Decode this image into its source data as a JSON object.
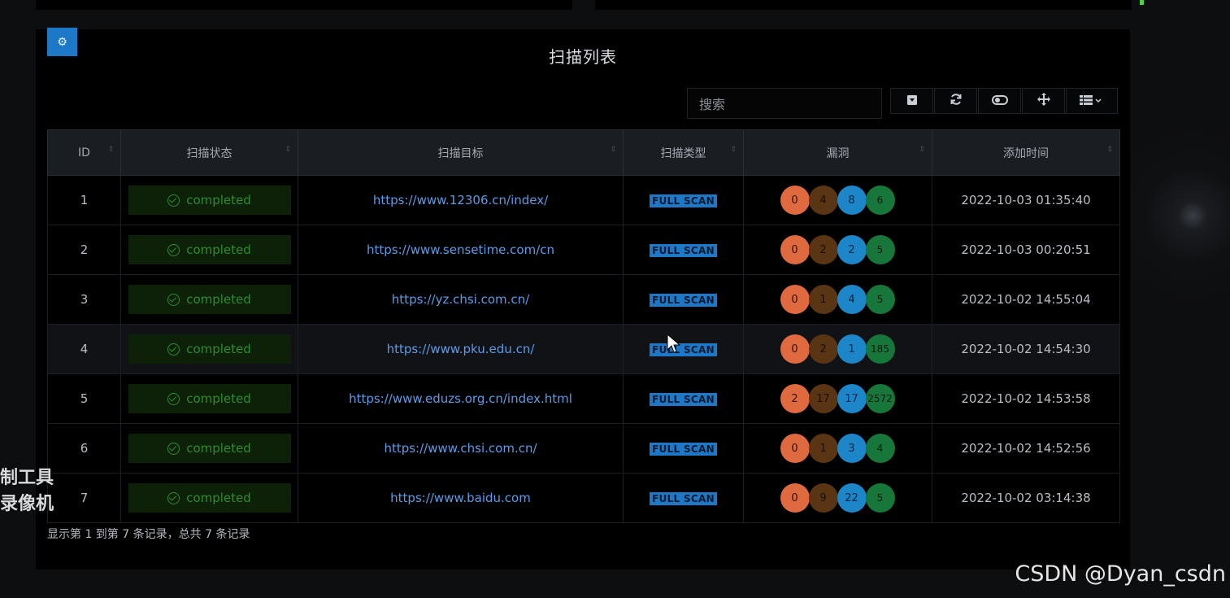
{
  "page": {
    "title": "扫描列表",
    "search_placeholder": "搜索"
  },
  "toolbar": {
    "buttons": [
      {
        "icon": "collapse-icon",
        "glyph": "▾"
      },
      {
        "icon": "refresh-icon",
        "glyph": "⟳"
      },
      {
        "icon": "toggle-icon",
        "glyph": "⊂⊃"
      },
      {
        "icon": "move-icon",
        "glyph": "✥"
      },
      {
        "icon": "columns-icon",
        "glyph": "☰ ⌄"
      }
    ]
  },
  "table": {
    "headers": [
      "ID",
      "扫描状态",
      "扫描目标",
      "扫描类型",
      "漏洞",
      "添加时间"
    ],
    "rows": [
      {
        "id": "1",
        "status": "completed",
        "target": "https://www.12306.cn/index/",
        "type": "FULL SCAN",
        "vulns": [
          "0",
          "4",
          "8",
          "6"
        ],
        "added": "2022-10-03 01:35:40"
      },
      {
        "id": "2",
        "status": "completed",
        "target": "https://www.sensetime.com/cn",
        "type": "FULL SCAN",
        "vulns": [
          "0",
          "2",
          "2",
          "5"
        ],
        "added": "2022-10-03 00:20:51"
      },
      {
        "id": "3",
        "status": "completed",
        "target": "https://yz.chsi.com.cn/",
        "type": "FULL SCAN",
        "vulns": [
          "0",
          "1",
          "4",
          "5"
        ],
        "added": "2022-10-02 14:55:04"
      },
      {
        "id": "4",
        "status": "completed",
        "target": "https://www.pku.edu.cn/",
        "type": "FULL SCAN",
        "vulns": [
          "0",
          "2",
          "1",
          "185"
        ],
        "added": "2022-10-02 14:54:30"
      },
      {
        "id": "5",
        "status": "completed",
        "target": "https://www.eduzs.org.cn/index.html",
        "type": "FULL SCAN",
        "vulns": [
          "2",
          "17",
          "17",
          "2572"
        ],
        "added": "2022-10-02 14:53:58"
      },
      {
        "id": "6",
        "status": "completed",
        "target": "https://www.chsi.com.cn/",
        "type": "FULL SCAN",
        "vulns": [
          "0",
          "1",
          "3",
          "4"
        ],
        "added": "2022-10-02 14:52:56"
      },
      {
        "id": "7",
        "status": "completed",
        "target": "https://www.baidu.com",
        "type": "FULL SCAN",
        "vulns": [
          "0",
          "9",
          "22",
          "5"
        ],
        "added": "2022-10-02 03:14:38"
      }
    ]
  },
  "footer": {
    "summary": "显示第 1 到第 7 条记录，总共 7 条记录"
  },
  "watermarks": {
    "left_line1": "制工具",
    "left_line2": "录像机",
    "csdn": "CSDN @Dyan_csdn"
  },
  "colors": {
    "accent": "#1e78c8",
    "completed_green": "#2f8c2f",
    "link_blue": "#5c9be6",
    "vuln_critical": "#e06a40",
    "vuln_high": "#5a3513",
    "vuln_medium": "#1d86c9",
    "vuln_low": "#17763a"
  }
}
